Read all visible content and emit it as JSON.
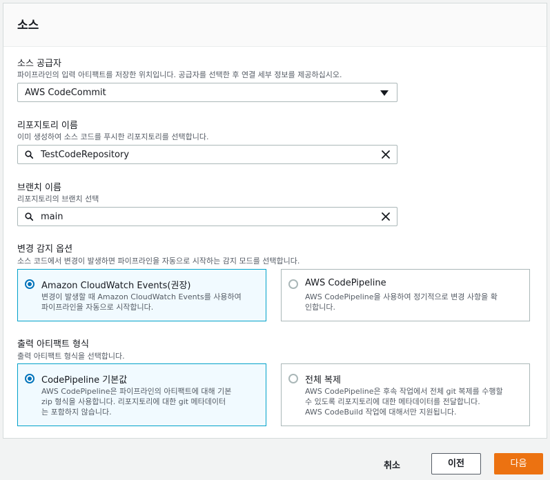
{
  "section": {
    "title": "소스"
  },
  "source_provider": {
    "label": "소스 공급자",
    "description": "파이프라인의 입력 아티팩트를 저장한 위치입니다. 공급자를 선택한 후 연결 세부 정보를 제공하십시오.",
    "value": "AWS CodeCommit"
  },
  "repository": {
    "label": "리포지토리 이름",
    "description": "이미 생성하여 소스 코드를 푸시한 리포지토리를 선택합니다.",
    "value": "TestCodeRepository"
  },
  "branch": {
    "label": "브랜치 이름",
    "description": "리포지토리의 브랜치 선택",
    "value": "main"
  },
  "change_detection": {
    "label": "변경 감지 옵션",
    "description": "소스 코드에서 변경이 발생하면 파이프라인을 자동으로 시작하는 감지 모드를 선택합니다.",
    "options": [
      {
        "title": "Amazon CloudWatch Events(권장)",
        "desc_line1": "변경이 발생할 때 Amazon CloudWatch Events를 사용하여",
        "desc_line2": "파이프라인을 자동으로 시작합니다.",
        "selected": true
      },
      {
        "title": "AWS CodePipeline",
        "desc_line1": "AWS CodePipeline을 사용하여 정기적으로 변경 사항을 확",
        "desc_line2": "인합니다.",
        "selected": false
      }
    ]
  },
  "artifact_format": {
    "label": "출력 아티팩트 형식",
    "description": "출력 아티팩트 형식을 선택합니다.",
    "options": [
      {
        "title": "CodePipeline 기본값",
        "desc_line1": "AWS CodePipeline은 파이프라인의 아티팩트에 대해 기본",
        "desc_line2": "zip 형식을 사용합니다. 리포지토리에 대한 git 메타데이터",
        "desc_line3": "는 포함하지 않습니다.",
        "selected": true
      },
      {
        "title": "전체 복제",
        "desc_line1": "AWS CodePipeline은 후속 작업에서 전체 git 복제를 수행할",
        "desc_line2": "수 있도록 리포지토리에 대한 메타데이터를 전달합니다.",
        "desc_line3": "AWS CodeBuild 작업에 대해서만 지원됩니다.",
        "selected": false
      }
    ]
  },
  "footer": {
    "cancel": "취소",
    "previous": "이전",
    "next": "다음"
  },
  "colors": {
    "accent": "#0073bb",
    "selected_border": "#00a1c9",
    "primary_button": "#ec7211"
  }
}
